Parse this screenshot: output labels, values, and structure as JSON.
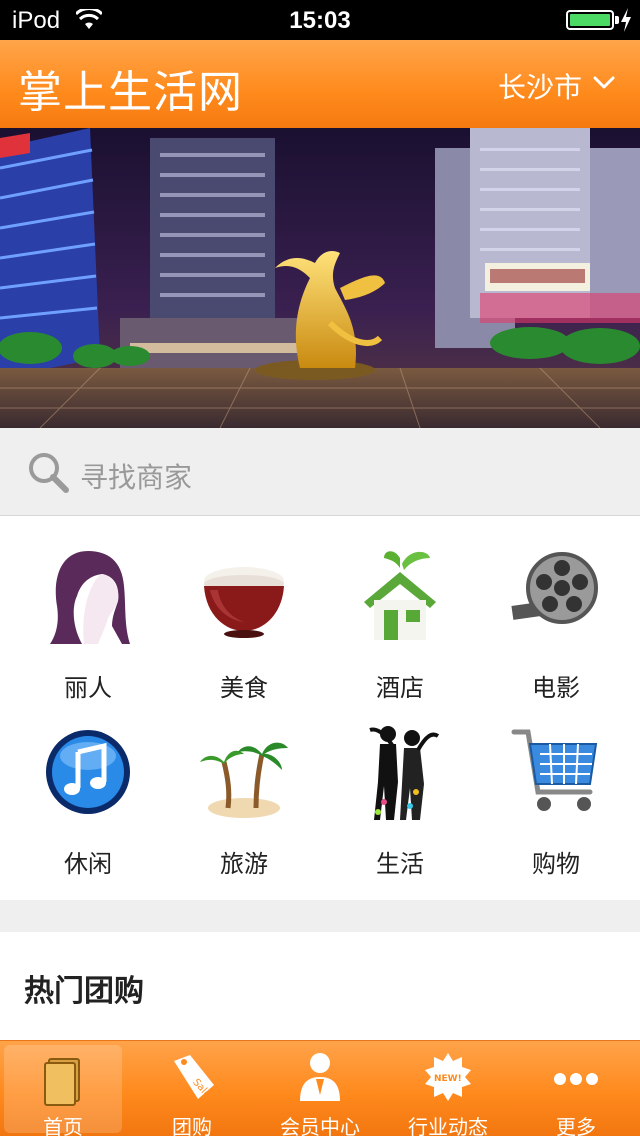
{
  "status_bar": {
    "carrier": "iPod",
    "time": "15:03",
    "battery_level": 1.0
  },
  "header": {
    "title": "掌上生活网",
    "city": "长沙市"
  },
  "search": {
    "placeholder": "寻找商家"
  },
  "categories": [
    {
      "label": "丽人",
      "icon": "woman-silhouette-icon"
    },
    {
      "label": "美食",
      "icon": "rice-bowl-icon"
    },
    {
      "label": "酒店",
      "icon": "house-icon"
    },
    {
      "label": "电影",
      "icon": "film-reel-icon"
    },
    {
      "label": "休闲",
      "icon": "music-note-icon"
    },
    {
      "label": "旅游",
      "icon": "palm-tree-icon"
    },
    {
      "label": "生活",
      "icon": "couple-silhouette-icon"
    },
    {
      "label": "购物",
      "icon": "shopping-cart-icon"
    }
  ],
  "section": {
    "title": "热门团购"
  },
  "tabs": [
    {
      "label": "首页",
      "icon": "book-icon",
      "active": true
    },
    {
      "label": "团购",
      "icon": "sale-tag-icon",
      "active": false
    },
    {
      "label": "会员中心",
      "icon": "member-icon",
      "active": false
    },
    {
      "label": "行业动态",
      "icon": "new-badge-icon",
      "active": false
    },
    {
      "label": "更多",
      "icon": "more-dots-icon",
      "active": false
    }
  ],
  "colors": {
    "accent": "#ff8a1c",
    "background": "#efefef"
  }
}
